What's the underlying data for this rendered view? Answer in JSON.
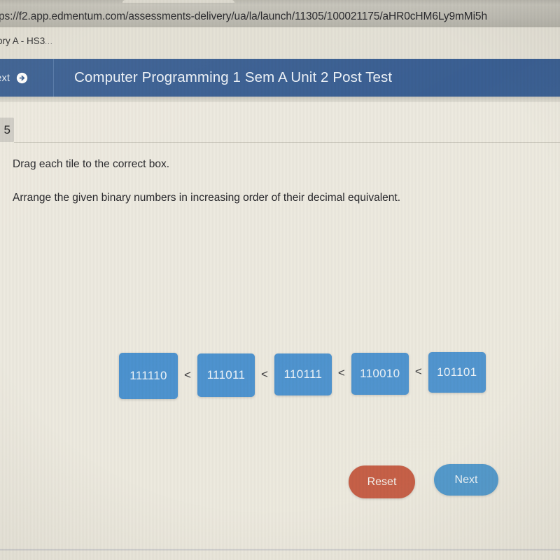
{
  "browser": {
    "url": "ps://f2.app.edmentum.com/assessments-delivery/ua/la/launch/11305/100021175/aHR0cHM6Ly9mMi5h",
    "bookmark_label": "ory A - HS3",
    "bookmark_ellipsis": "..."
  },
  "app_header": {
    "nav_label": "ext",
    "nav_icon": "arrow-right-circle-icon",
    "title": "Computer Programming 1 Sem A Unit 2 Post Test",
    "background_color": "#3a5f93"
  },
  "question": {
    "number": "5",
    "instruction_line_1": "Drag each tile to the correct box.",
    "instruction_line_2": "Arrange the given binary numbers in increasing order of their decimal equivalent."
  },
  "tiles": [
    {
      "value": "111110"
    },
    {
      "value": "111011"
    },
    {
      "value": "110111"
    },
    {
      "value": "110010"
    },
    {
      "value": "101101"
    }
  ],
  "separators": [
    "<",
    "<",
    "<",
    "<"
  ],
  "buttons": {
    "reset_label": "Reset",
    "reset_color": "#c4583f",
    "next_label": "Next",
    "next_color": "#4a95cc"
  },
  "colors": {
    "tile_blue": "#4a91cf",
    "page_background": "#edeae0",
    "header_blue": "#3a5f93"
  }
}
